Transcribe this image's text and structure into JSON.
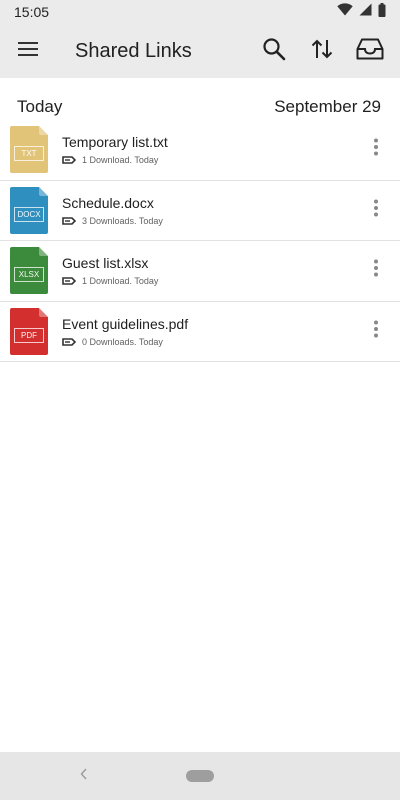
{
  "status_bar": {
    "time": "15:05",
    "icons": [
      "wifi-icon",
      "signal-icon",
      "battery-icon"
    ]
  },
  "app_bar": {
    "title": "Shared Links",
    "icons": [
      "menu-icon",
      "search-icon",
      "sort-icon",
      "inbox-icon"
    ]
  },
  "group": {
    "title": "Today",
    "date": "September 29"
  },
  "files": [
    {
      "name": "Temporary list.txt",
      "meta": "1 Download. Today",
      "ext": "TXT",
      "color": "#e2c478"
    },
    {
      "name": "Schedule.docx",
      "meta": "3 Downloads. Today",
      "ext": "DOCX",
      "color": "#2f8fbf"
    },
    {
      "name": "Guest list.xlsx",
      "meta": "1 Download. Today",
      "ext": "XLSX",
      "color": "#3c8a3b"
    },
    {
      "name": "Event guidelines.pdf",
      "meta": "0 Downloads. Today",
      "ext": "PDF",
      "color": "#d32f2f"
    }
  ],
  "colors": {
    "appbar_bg": "#ebebeb",
    "navbar_bg": "#e6e6e6",
    "divider": "#e2e2e2"
  }
}
